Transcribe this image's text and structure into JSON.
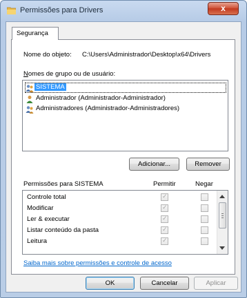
{
  "window": {
    "title": "Permissões para Drivers",
    "close_label": "x",
    "accent_close": "#c7401f",
    "frame_color": "#b9cde6"
  },
  "tabs": [
    {
      "label": "Segurança",
      "selected": true
    }
  ],
  "object": {
    "label": "Nome do objeto:",
    "value": "C:\\Users\\Administrador\\Desktop\\x64\\Drivers"
  },
  "groups": {
    "label": "Nomes de grupo ou de usuário:",
    "items": [
      {
        "label": "SISTEMA",
        "icon": "users-group-icon",
        "selected": true
      },
      {
        "label": "Administrador (Administrador-Administrador)",
        "icon": "user-icon",
        "selected": false
      },
      {
        "label": "Administradores (Administrador-Administradores)",
        "icon": "users-group-icon",
        "selected": false
      }
    ],
    "add_button": "Adicionar...",
    "remove_button": "Remover"
  },
  "permissions": {
    "label": "Permissões para SISTEMA",
    "allow_header": "Permitir",
    "deny_header": "Negar",
    "rows": [
      {
        "label": "Controle total",
        "allow": true,
        "deny": false
      },
      {
        "label": "Modificar",
        "allow": true,
        "deny": false
      },
      {
        "label": "Ler & executar",
        "allow": true,
        "deny": false
      },
      {
        "label": "Listar conteúdo da pasta",
        "allow": true,
        "deny": false
      },
      {
        "label": "Leitura",
        "allow": true,
        "deny": false
      }
    ]
  },
  "help_link": "Saiba mais sobre permissões e controle de acesso",
  "footer": {
    "ok": "OK",
    "cancel": "Cancelar",
    "apply": "Aplicar"
  }
}
